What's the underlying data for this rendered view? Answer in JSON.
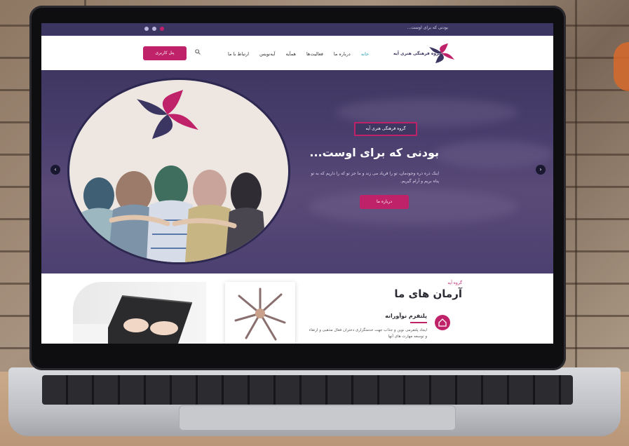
{
  "topbar": {
    "tagline": "بودنی که برای اوست...",
    "social_icons": [
      "share-icon",
      "instagram-icon",
      "telegram-icon"
    ]
  },
  "nav": {
    "brand": "گروه فرهنگی هنری آیه",
    "items": [
      "خانه",
      "درباره ما",
      "فعالیت‌ها",
      "همآیه",
      "آیه‌نویس",
      "ارتباط با ما"
    ],
    "active_index": 0,
    "panel_button": "پنل کاربری"
  },
  "hero": {
    "badge": "گروه فرهنگی هنری آیه",
    "title": "بودنی که برای اوست...",
    "text": "اینک ذره ذره وجودمان، تو را فریاد می زند و ما جز تو که را داریم که به تو پناه بریم و آرام گیریم.",
    "button": "درباره ما"
  },
  "section": {
    "eyebrow": "گروه آیه",
    "title": "آرمان های ما",
    "feature_title": "پلتفرم نوآورانه",
    "feature_text": "ایجاد پلتفرمی نوین و جذاب جهت خدمتگزاری دختران فعال مذهبی و ارتقاء و توسعه مهارت های آنها"
  },
  "colors": {
    "brand_purple": "#3b3561",
    "accent_pink": "#c0226a",
    "active_teal": "#27a3b3"
  }
}
